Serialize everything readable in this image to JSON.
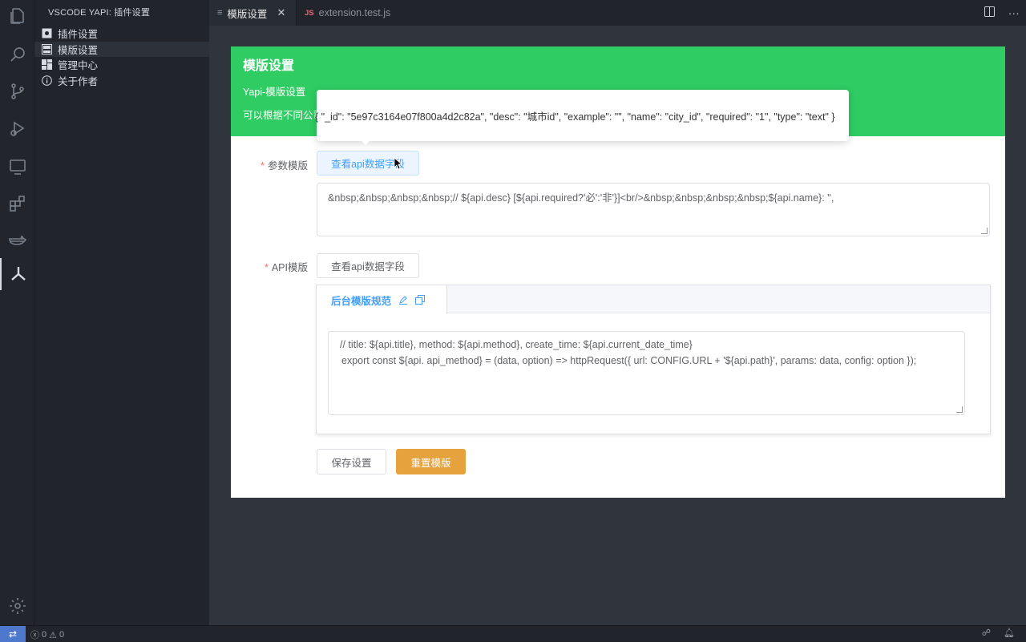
{
  "sidebar": {
    "title": "VSCODE YAPI: 插件设置",
    "items": [
      {
        "label": "插件设置",
        "icon": "gear-square-icon"
      },
      {
        "label": "模版设置",
        "icon": "layout-icon"
      },
      {
        "label": "管理中心",
        "icon": "dashboard-icon"
      },
      {
        "label": "关于作者",
        "icon": "info-icon"
      }
    ]
  },
  "tabs": {
    "active": {
      "label": "模版设置",
      "close": "✕"
    },
    "inactive": {
      "label": "extension.test.js",
      "badge": "JS"
    }
  },
  "banner": {
    "title": "模版设置",
    "subtitle": "Yapi-模版设置",
    "desc": "可以根据不同公司"
  },
  "tooltip": {
    "text": "{ \"_id\": \"5e97c3164e07f800a4d2c82a\", \"desc\": \"城市id\", \"example\": \"\", \"name\": \"city_id\", \"required\": \"1\", \"type\": \"text\" }"
  },
  "form": {
    "param_label": "参数模版",
    "param_button": "查看api数据字段",
    "param_value": "&nbsp;&nbsp;&nbsp;&nbsp;// ${api.desc} [${api.required?'必':'非'}]<br/>&nbsp;&nbsp;&nbsp;&nbsp;${api.name}: '',",
    "api_label": "API模版",
    "api_button": "查看api数据字段",
    "api_tab_label": "后台模版规范",
    "api_line1": "// title: ${api.title}, method: ${api.method}, create_time: ${api.current_date_time}",
    "api_line2": "export const ${api. api_method} = (data, option) => httpRequest({ url: CONFIG.URL + '${api.path}', params: data, config: option });",
    "save_button": "保存设置",
    "reset_button": "重置模版"
  },
  "status": {
    "errors": "0",
    "warnings": "0"
  },
  "colors": {
    "banner": "#2ecc62",
    "primary": "#409eff",
    "warning": "#e6a23c",
    "required": "#f56c6c"
  }
}
